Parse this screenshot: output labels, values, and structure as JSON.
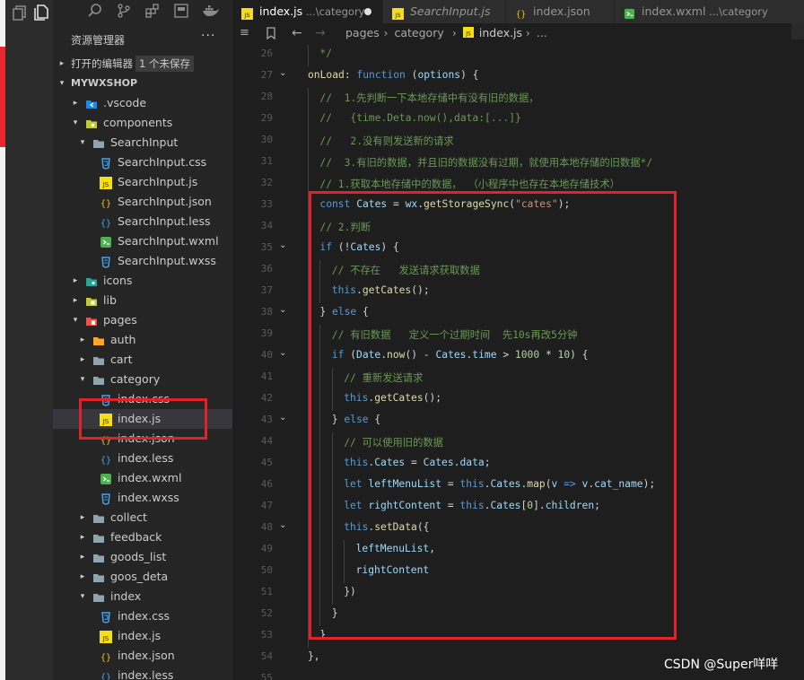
{
  "explorer": {
    "title": "资源管理器",
    "open_editors_label": "打开的编辑器",
    "unsaved_badge": "1 个未保存",
    "workspace_name": "MYWXSHOP"
  },
  "tree": [
    {
      "label": ".vscode",
      "depth": 1,
      "kind": "folder-vscode",
      "chevron": "right"
    },
    {
      "label": "components",
      "depth": 1,
      "kind": "folder-components",
      "chevron": "down"
    },
    {
      "label": "SearchInput",
      "depth": 2,
      "kind": "folder",
      "chevron": "down"
    },
    {
      "label": "SearchInput.css",
      "depth": 3,
      "kind": "css"
    },
    {
      "label": "SearchInput.js",
      "depth": 3,
      "kind": "js"
    },
    {
      "label": "SearchInput.json",
      "depth": 3,
      "kind": "json"
    },
    {
      "label": "SearchInput.less",
      "depth": 3,
      "kind": "less"
    },
    {
      "label": "SearchInput.wxml",
      "depth": 3,
      "kind": "wxml"
    },
    {
      "label": "SearchInput.wxss",
      "depth": 3,
      "kind": "wxss"
    },
    {
      "label": "icons",
      "depth": 1,
      "kind": "folder-icons",
      "chevron": "right"
    },
    {
      "label": "lib",
      "depth": 1,
      "kind": "folder-lib",
      "chevron": "right"
    },
    {
      "label": "pages",
      "depth": 1,
      "kind": "folder-pages",
      "chevron": "down"
    },
    {
      "label": "auth",
      "depth": 2,
      "kind": "folder-auth",
      "chevron": "right"
    },
    {
      "label": "cart",
      "depth": 2,
      "kind": "folder",
      "chevron": "right"
    },
    {
      "label": "category",
      "depth": 2,
      "kind": "folder",
      "chevron": "down"
    },
    {
      "label": "index.css",
      "depth": 3,
      "kind": "css"
    },
    {
      "label": "index.js",
      "depth": 3,
      "kind": "js",
      "selected": true
    },
    {
      "label": "index.json",
      "depth": 3,
      "kind": "json"
    },
    {
      "label": "index.less",
      "depth": 3,
      "kind": "less"
    },
    {
      "label": "index.wxml",
      "depth": 3,
      "kind": "wxml"
    },
    {
      "label": "index.wxss",
      "depth": 3,
      "kind": "wxss"
    },
    {
      "label": "collect",
      "depth": 2,
      "kind": "folder",
      "chevron": "right"
    },
    {
      "label": "feedback",
      "depth": 2,
      "kind": "folder",
      "chevron": "right"
    },
    {
      "label": "goods_list",
      "depth": 2,
      "kind": "folder",
      "chevron": "right"
    },
    {
      "label": "goos_deta",
      "depth": 2,
      "kind": "folder",
      "chevron": "right"
    },
    {
      "label": "index",
      "depth": 2,
      "kind": "folder",
      "chevron": "down"
    },
    {
      "label": "index.css",
      "depth": 3,
      "kind": "css"
    },
    {
      "label": "index.js",
      "depth": 3,
      "kind": "js"
    },
    {
      "label": "index.json",
      "depth": 3,
      "kind": "json"
    },
    {
      "label": "index.less",
      "depth": 3,
      "kind": "less"
    }
  ],
  "tabs": [
    {
      "name": "index.js",
      "desc": "...\\category",
      "kind": "js",
      "active": true,
      "dirty": true
    },
    {
      "name": "SearchInput.js",
      "desc": "",
      "kind": "js",
      "italic": true
    },
    {
      "name": "index.json",
      "desc": "",
      "kind": "json"
    },
    {
      "name": "index.wxml",
      "desc": "...\\category",
      "kind": "wxml"
    }
  ],
  "breadcrumb": [
    "pages",
    "category",
    "index.js",
    "..."
  ],
  "code_lines": [
    {
      "n": 26,
      "indent": 1,
      "tokens": [
        [
          "c",
          "*/"
        ]
      ]
    },
    {
      "n": 27,
      "indent": 0,
      "fold": true,
      "tokens": [
        [
          "f",
          "onLoad"
        ],
        [
          "o",
          ": "
        ],
        [
          "k",
          "function"
        ],
        [
          "o",
          " ("
        ],
        [
          "p",
          "options"
        ],
        [
          "o",
          ") {"
        ]
      ]
    },
    {
      "n": 28,
      "indent": 1,
      "tokens": [
        [
          "c",
          "//  1.先判断一下本地存储中有没有旧的数据，"
        ]
      ]
    },
    {
      "n": 29,
      "indent": 1,
      "tokens": [
        [
          "c",
          "//   {time.Deta.now(),data:[...]}"
        ]
      ]
    },
    {
      "n": 30,
      "indent": 1,
      "tokens": [
        [
          "c",
          "//   2.没有则发送新的请求"
        ]
      ]
    },
    {
      "n": 31,
      "indent": 1,
      "tokens": [
        [
          "c",
          "//  3.有旧的数据，并且旧的数据没有过期，就使用本地存储的旧数据*/"
        ]
      ]
    },
    {
      "n": 32,
      "indent": 1,
      "tokens": [
        [
          "c",
          "// 1.获取本地存储中的数据， （小程序中也存在本地存储技术）"
        ]
      ]
    },
    {
      "n": 33,
      "indent": 1,
      "tokens": [
        [
          "k",
          "const "
        ],
        [
          "p",
          "Cates"
        ],
        [
          "o",
          " = "
        ],
        [
          "p",
          "wx"
        ],
        [
          "o",
          "."
        ],
        [
          "f",
          "getStorageSync"
        ],
        [
          "o",
          "("
        ],
        [
          "s",
          "\"cates\""
        ],
        [
          "o",
          ");"
        ]
      ]
    },
    {
      "n": 34,
      "indent": 1,
      "tokens": [
        [
          "c",
          "// 2.判断"
        ]
      ]
    },
    {
      "n": 35,
      "indent": 1,
      "fold": true,
      "tokens": [
        [
          "k",
          "if"
        ],
        [
          "o",
          " (!"
        ],
        [
          "p",
          "Cates"
        ],
        [
          "o",
          ") {"
        ]
      ]
    },
    {
      "n": 36,
      "indent": 2,
      "tokens": [
        [
          "c",
          "// 不存在   发送请求获取数据"
        ]
      ]
    },
    {
      "n": 37,
      "indent": 2,
      "tokens": [
        [
          "k",
          "this"
        ],
        [
          "o",
          "."
        ],
        [
          "f",
          "getCates"
        ],
        [
          "o",
          "();"
        ]
      ]
    },
    {
      "n": 38,
      "indent": 1,
      "fold": true,
      "tokens": [
        [
          "o",
          "} "
        ],
        [
          "k",
          "else"
        ],
        [
          "o",
          " {"
        ]
      ]
    },
    {
      "n": 39,
      "indent": 2,
      "tokens": [
        [
          "c",
          "// 有旧数据   定义一个过期时间  先10s再改5分钟"
        ]
      ]
    },
    {
      "n": 40,
      "indent": 2,
      "fold": true,
      "tokens": [
        [
          "k",
          "if"
        ],
        [
          "o",
          " ("
        ],
        [
          "p",
          "Date"
        ],
        [
          "o",
          "."
        ],
        [
          "f",
          "now"
        ],
        [
          "o",
          "() - "
        ],
        [
          "p",
          "Cates"
        ],
        [
          "o",
          "."
        ],
        [
          "p",
          "time"
        ],
        [
          "o",
          " > "
        ],
        [
          "n",
          "1000"
        ],
        [
          "o",
          " * "
        ],
        [
          "n",
          "10"
        ],
        [
          "o",
          ") {"
        ]
      ]
    },
    {
      "n": 41,
      "indent": 3,
      "tokens": [
        [
          "c",
          "// 重新发送请求"
        ]
      ]
    },
    {
      "n": 42,
      "indent": 3,
      "tokens": [
        [
          "k",
          "this"
        ],
        [
          "o",
          "."
        ],
        [
          "f",
          "getCates"
        ],
        [
          "o",
          "();"
        ]
      ]
    },
    {
      "n": 43,
      "indent": 2,
      "fold": true,
      "tokens": [
        [
          "o",
          "} "
        ],
        [
          "k",
          "else"
        ],
        [
          "o",
          " {"
        ]
      ]
    },
    {
      "n": 44,
      "indent": 3,
      "tokens": [
        [
          "c",
          "// 可以使用旧的数据"
        ]
      ]
    },
    {
      "n": 45,
      "indent": 3,
      "tokens": [
        [
          "k",
          "this"
        ],
        [
          "o",
          "."
        ],
        [
          "p",
          "Cates"
        ],
        [
          "o",
          " = "
        ],
        [
          "p",
          "Cates"
        ],
        [
          "o",
          "."
        ],
        [
          "p",
          "data"
        ],
        [
          "o",
          ";"
        ]
      ]
    },
    {
      "n": 46,
      "indent": 3,
      "tokens": [
        [
          "k",
          "let "
        ],
        [
          "p",
          "leftMenuList"
        ],
        [
          "o",
          " = "
        ],
        [
          "k",
          "this"
        ],
        [
          "o",
          "."
        ],
        [
          "p",
          "Cates"
        ],
        [
          "o",
          "."
        ],
        [
          "f",
          "map"
        ],
        [
          "o",
          "("
        ],
        [
          "p",
          "v"
        ],
        [
          "k",
          " => "
        ],
        [
          "p",
          "v"
        ],
        [
          "o",
          "."
        ],
        [
          "p",
          "cat_name"
        ],
        [
          "o",
          ");"
        ]
      ]
    },
    {
      "n": 47,
      "indent": 3,
      "tokens": [
        [
          "k",
          "let "
        ],
        [
          "p",
          "rightContent"
        ],
        [
          "o",
          " = "
        ],
        [
          "k",
          "this"
        ],
        [
          "o",
          "."
        ],
        [
          "p",
          "Cates"
        ],
        [
          "o",
          "["
        ],
        [
          "n",
          "0"
        ],
        [
          "o",
          "]."
        ],
        [
          "p",
          "children"
        ],
        [
          "o",
          ";"
        ]
      ]
    },
    {
      "n": 48,
      "indent": 3,
      "fold": true,
      "tokens": [
        [
          "k",
          "this"
        ],
        [
          "o",
          "."
        ],
        [
          "f",
          "setData"
        ],
        [
          "o",
          "({"
        ]
      ]
    },
    {
      "n": 49,
      "indent": 4,
      "tokens": [
        [
          "p",
          "leftMenuList"
        ],
        [
          "o",
          ","
        ]
      ]
    },
    {
      "n": 50,
      "indent": 4,
      "tokens": [
        [
          "p",
          "rightContent"
        ]
      ]
    },
    {
      "n": 51,
      "indent": 3,
      "tokens": [
        [
          "o",
          "})"
        ]
      ]
    },
    {
      "n": 52,
      "indent": 2,
      "tokens": [
        [
          "o",
          "}"
        ]
      ]
    },
    {
      "n": 53,
      "indent": 1,
      "tokens": [
        [
          "o",
          "}"
        ]
      ]
    },
    {
      "n": 54,
      "indent": 0,
      "tokens": [
        [
          "o",
          "},"
        ]
      ]
    },
    {
      "n": 55,
      "indent": 0,
      "tokens": []
    }
  ],
  "watermark": "CSDN @Super咩咩",
  "colors": {
    "highlight_box": "#e0232a",
    "comment": "#6a9955",
    "keyword": "#569cd6",
    "string": "#ce9178"
  }
}
